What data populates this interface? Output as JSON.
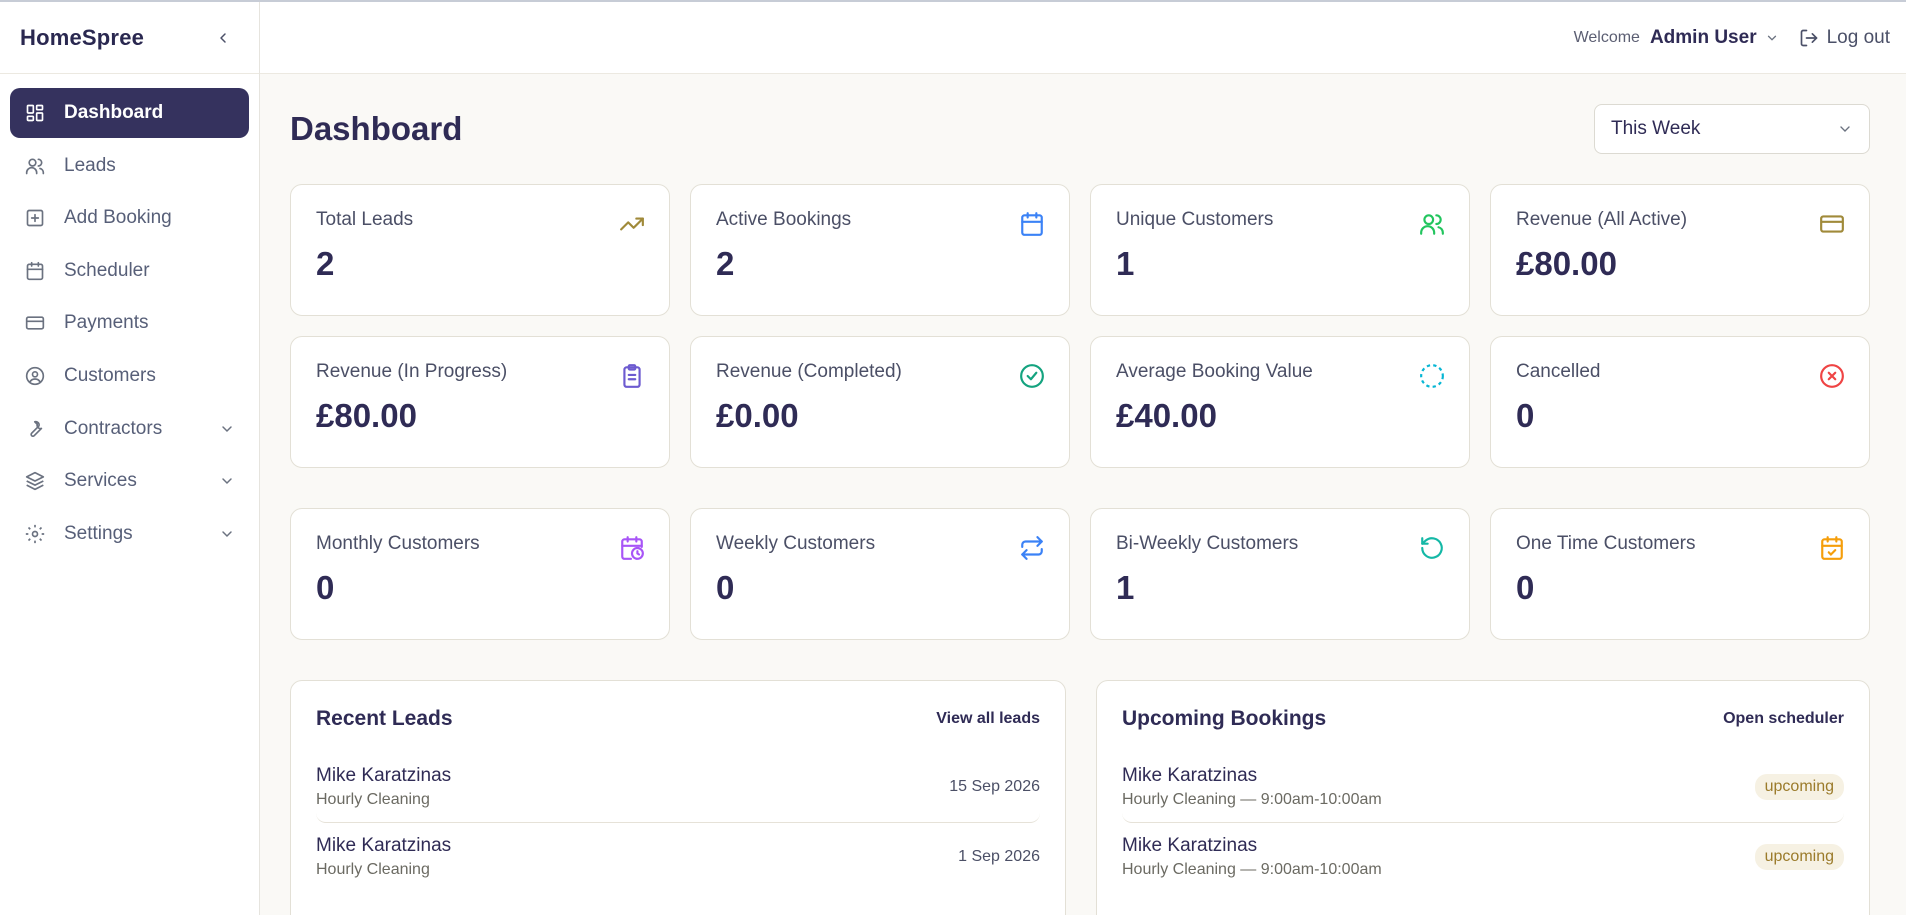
{
  "brand": "HomeSpree",
  "sidebar": {
    "items": [
      {
        "label": "Dashboard"
      },
      {
        "label": "Leads"
      },
      {
        "label": "Add Booking"
      },
      {
        "label": "Scheduler"
      },
      {
        "label": "Payments"
      },
      {
        "label": "Customers"
      },
      {
        "label": "Contractors"
      },
      {
        "label": "Services"
      },
      {
        "label": "Settings"
      }
    ]
  },
  "topbar": {
    "welcome": "Welcome",
    "user": "Admin User",
    "logout": "Log out"
  },
  "page": {
    "title": "Dashboard",
    "range": "This Week"
  },
  "stats": [
    {
      "label": "Total Leads",
      "value": "2"
    },
    {
      "label": "Active Bookings",
      "value": "2"
    },
    {
      "label": "Unique Customers",
      "value": "1"
    },
    {
      "label": "Revenue (All Active)",
      "value": "£80.00"
    },
    {
      "label": "Revenue (In Progress)",
      "value": "£80.00"
    },
    {
      "label": "Revenue (Completed)",
      "value": "£0.00"
    },
    {
      "label": "Average Booking Value",
      "value": "£40.00"
    },
    {
      "label": "Cancelled",
      "value": "0"
    },
    {
      "label": "Monthly Customers",
      "value": "0"
    },
    {
      "label": "Weekly Customers",
      "value": "0"
    },
    {
      "label": "Bi-Weekly Customers",
      "value": "1"
    },
    {
      "label": "One Time Customers",
      "value": "0"
    }
  ],
  "recent_leads": {
    "title": "Recent Leads",
    "link": "View all leads",
    "items": [
      {
        "name": "Mike Karatzinas",
        "service": "Hourly Cleaning",
        "date": "15 Sep 2026"
      },
      {
        "name": "Mike Karatzinas",
        "service": "Hourly Cleaning",
        "date": "1 Sep 2026"
      }
    ]
  },
  "upcoming": {
    "title": "Upcoming Bookings",
    "link": "Open scheduler",
    "items": [
      {
        "name": "Mike Karatzinas",
        "detail": "Hourly Cleaning — 9:00am-10:00am",
        "status": "upcoming"
      },
      {
        "name": "Mike Karatzinas",
        "detail": "Hourly Cleaning — 9:00am-10:00am",
        "status": "upcoming"
      }
    ]
  },
  "colors": {
    "sidebar_active": "#35325e",
    "trend": "#a08a3a",
    "blue": "#3b82f6",
    "green": "#22c55e",
    "purple": "#6d5bd0",
    "teal": "#14b8a6",
    "cyan": "#06b6d4",
    "red": "#ef4444",
    "orange": "#f59e0b",
    "violet": "#a855f7"
  }
}
